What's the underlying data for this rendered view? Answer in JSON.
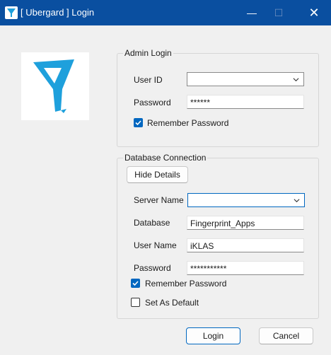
{
  "window": {
    "title": "[ Ubergard ] Login",
    "minimize_glyph": "—",
    "maximize_glyph": "☐",
    "close_glyph": "✕"
  },
  "admin_login": {
    "legend": "Admin Login",
    "user_id_label": "User ID",
    "user_id_value": "",
    "password_label": "Password",
    "password_value": "******",
    "remember_label": "Remember Password",
    "remember_checked": true
  },
  "database": {
    "legend": "Database Connection",
    "hide_details_label": "Hide Details",
    "server_label": "Server Name",
    "server_value": "",
    "database_label": "Database",
    "database_value": "Fingerprint_Apps",
    "username_label": "User Name",
    "username_value": "iKLAS",
    "password_label": "Password",
    "password_value": "***********",
    "remember_label": "Remember Password",
    "remember_checked": true,
    "default_label": "Set As Default",
    "default_checked": false
  },
  "actions": {
    "login_label": "Login",
    "cancel_label": "Cancel"
  },
  "colors": {
    "titlebar": "#0a4fa0",
    "logo_blue": "#1ea0dc",
    "accent": "#0067c0"
  },
  "icons": {
    "app": "ubergard-logo-icon",
    "dropdown": "chevron-down-icon",
    "check": "checkmark-icon"
  }
}
